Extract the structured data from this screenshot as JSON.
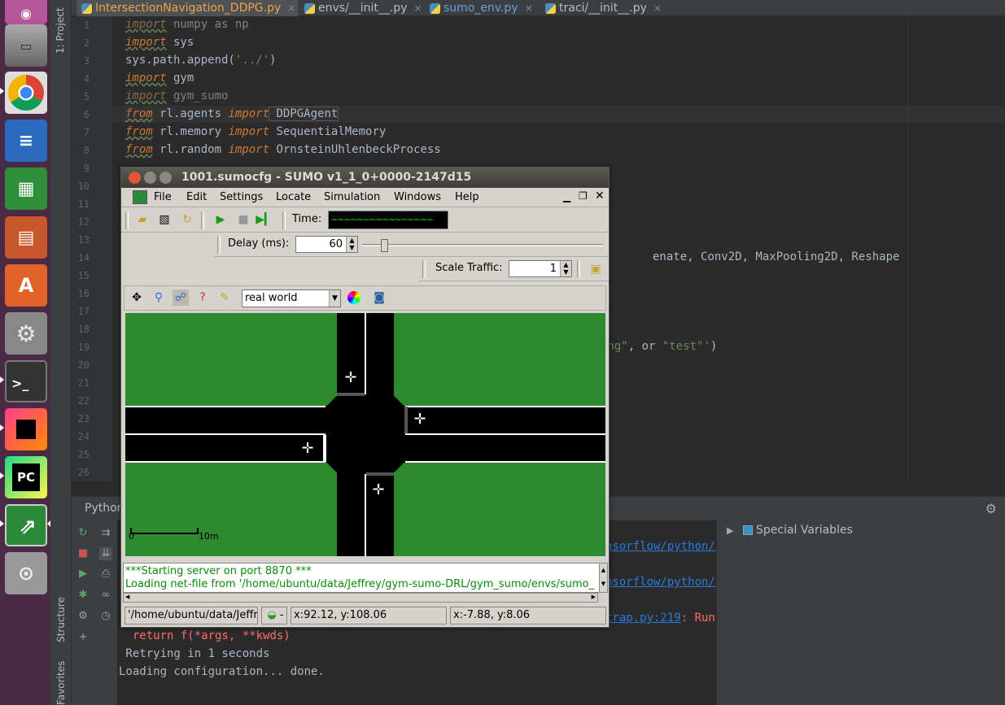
{
  "launcher": {
    "items": [
      "ubuntu-icon",
      "files-icon",
      "chrome-icon",
      "writer-icon",
      "calc-icon",
      "impress-icon",
      "software-center-icon",
      "settings-icon",
      "terminal-icon",
      "jetbrains-toolbox-icon",
      "pycharm-icon",
      "sumo-icon",
      "disk-icon"
    ]
  },
  "ide": {
    "tool_window_labels": {
      "project": "1: Project",
      "structure": "Structure",
      "favorites": "Favorites"
    },
    "tabs": [
      {
        "label": "IntersectionNavigation_DDPG.py"
      },
      {
        "label": "envs/__init__.py"
      },
      {
        "label": "sumo_env.py"
      },
      {
        "label": "traci/__init__.py"
      }
    ],
    "line_numbers": [
      "1",
      "2",
      "3",
      "4",
      "5",
      "6",
      "7",
      "8",
      "9",
      "10",
      "11",
      "12",
      "13",
      "14",
      "15",
      "16",
      "17",
      "18",
      "19",
      "20",
      "21",
      "22",
      "23",
      "24",
      "25",
      "26"
    ],
    "code": {
      "l1_kw": "import",
      "l1_rest": " numpy as np",
      "l2_kw": "import",
      "l2_rest": " sys",
      "l3": "sys.path.append(",
      "l3_str": "'../'",
      "l3_end": ")",
      "l4_kw": "import",
      "l4_rest": " gym",
      "l5_kw": "import",
      "l5_rest": " gym_sumo",
      "l6_kw": "from",
      "l6_mod": " rl.agents ",
      "l6_kw2": "import",
      "l6_name": " DDPGAgent",
      "l7_kw": "from",
      "l7_mod": " rl.memory ",
      "l7_kw2": "import",
      "l7_name": " SequentialMemory",
      "l8_kw": "from",
      "l8_mod": " rl.random ",
      "l8_kw2": "import",
      "l8_name": " OrnsteinUhlenbeckProcess",
      "l14_frag": "enate, Conv2D, MaxPooling2D, Reshape",
      "l19_frag_a": "ing\"",
      "l19_frag_b": ", or ",
      "l19_frag_c": "\"test\"'",
      "l19_frag_d": ")"
    },
    "run_panel": {
      "title": "Python"
    },
    "console": {
      "frag1": "nsorflow/python/f",
      "frag2": "nsorflow/python/f",
      "frag3_link": "trap.py:219",
      "frag3_rest": ": Runt",
      "line1": "  return f(*args, **kwds)",
      "line2": " Retrying in 1 seconds",
      "line3": "Loading configuration... done."
    },
    "variables": {
      "label": "Special Variables"
    }
  },
  "sumo": {
    "title": "1001.sumocfg - SUMO v1_1_0+0000-2147d15",
    "menu": [
      "File",
      "Edit",
      "Settings",
      "Locate",
      "Simulation",
      "Windows",
      "Help"
    ],
    "time_label": "Time:",
    "time_value": "~~~~~~~~~~~~~~~~",
    "delay_label": "Delay (ms):",
    "delay_value": "60",
    "delay_fraction": 0.09,
    "scale_label": "Scale Traffic:",
    "scale_value": "1",
    "view_scheme": "real world",
    "scale_bar": {
      "zero": "0",
      "ten": "10m"
    },
    "messages": [
      "***Starting server on port 8870 ***",
      "Loading net-file from '/home/ubuntu/data/Jeffrey/gym-sumo-DRL/gym_sumo/envs/sumo_"
    ],
    "status": {
      "path": "'/home/ubuntu/data/Jeffr",
      "vehicle_btn": "-",
      "coord1": "x:92.12, y:108.06",
      "coord2": "x:-7.88, y:8.06"
    }
  }
}
